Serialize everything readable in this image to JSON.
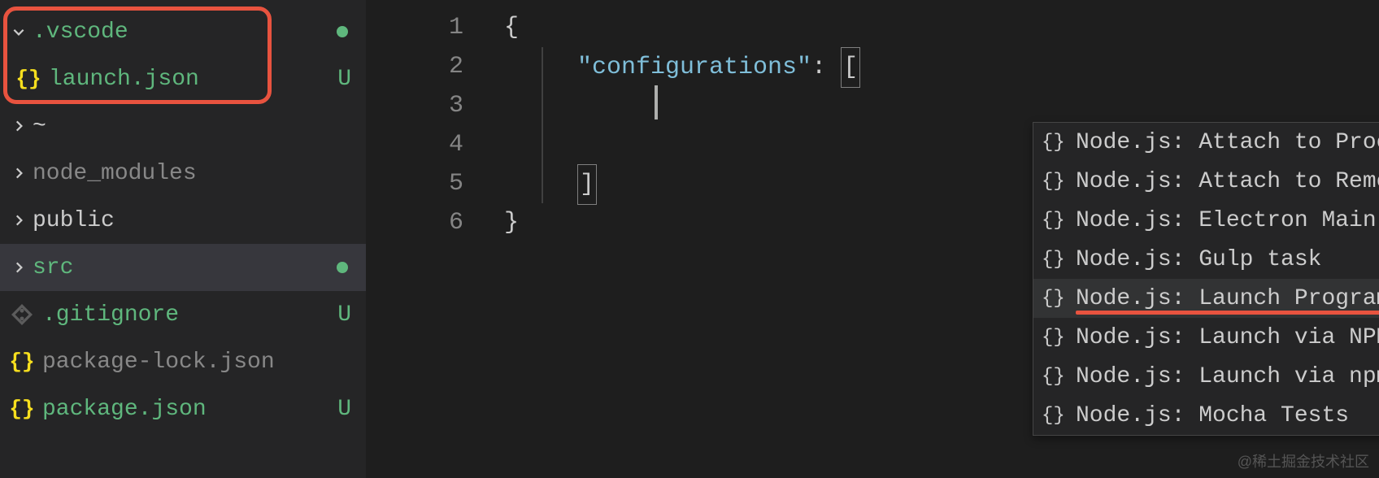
{
  "sidebar": {
    "items": [
      {
        "label": ".vscode",
        "type": "folder",
        "expanded": true,
        "color": "green",
        "status": "dot"
      },
      {
        "label": "launch.json",
        "type": "json",
        "color": "green",
        "status": "U",
        "indent": 1
      },
      {
        "label": "~",
        "type": "folder",
        "expanded": false,
        "color": "light"
      },
      {
        "label": "node_modules",
        "type": "folder",
        "expanded": false,
        "color": "gray"
      },
      {
        "label": "public",
        "type": "folder",
        "expanded": false,
        "color": "light"
      },
      {
        "label": "src",
        "type": "folder",
        "expanded": false,
        "color": "green",
        "selected": true,
        "status": "dot"
      },
      {
        "label": ".gitignore",
        "type": "git",
        "color": "green",
        "status": "U"
      },
      {
        "label": "package-lock.json",
        "type": "json",
        "color": "gray"
      },
      {
        "label": "package.json",
        "type": "json",
        "color": "green",
        "status": "U"
      }
    ]
  },
  "editor": {
    "lines": [
      "1",
      "2",
      "3",
      "4",
      "5",
      "6"
    ],
    "code": {
      "open_brace": "{",
      "key": "\"configurations\"",
      "colon": ": ",
      "open_bracket": "[",
      "close_bracket": "]",
      "close_brace": "}"
    }
  },
  "suggestions": [
    {
      "label": "Node.js: Attach to Process"
    },
    {
      "label": "Node.js: Attach to Remote Program"
    },
    {
      "label": "Node.js: Electron Main"
    },
    {
      "label": "Node.js: Gulp task"
    },
    {
      "label": "Node.js: Launch Program",
      "focused": true,
      "underline": true
    },
    {
      "label": "Node.js: Launch via NPM"
    },
    {
      "label": "Node.js: Launch via npm"
    },
    {
      "label": "Node.js: Mocha Tests"
    }
  ],
  "watermark": "@稀土掘金技术社区"
}
